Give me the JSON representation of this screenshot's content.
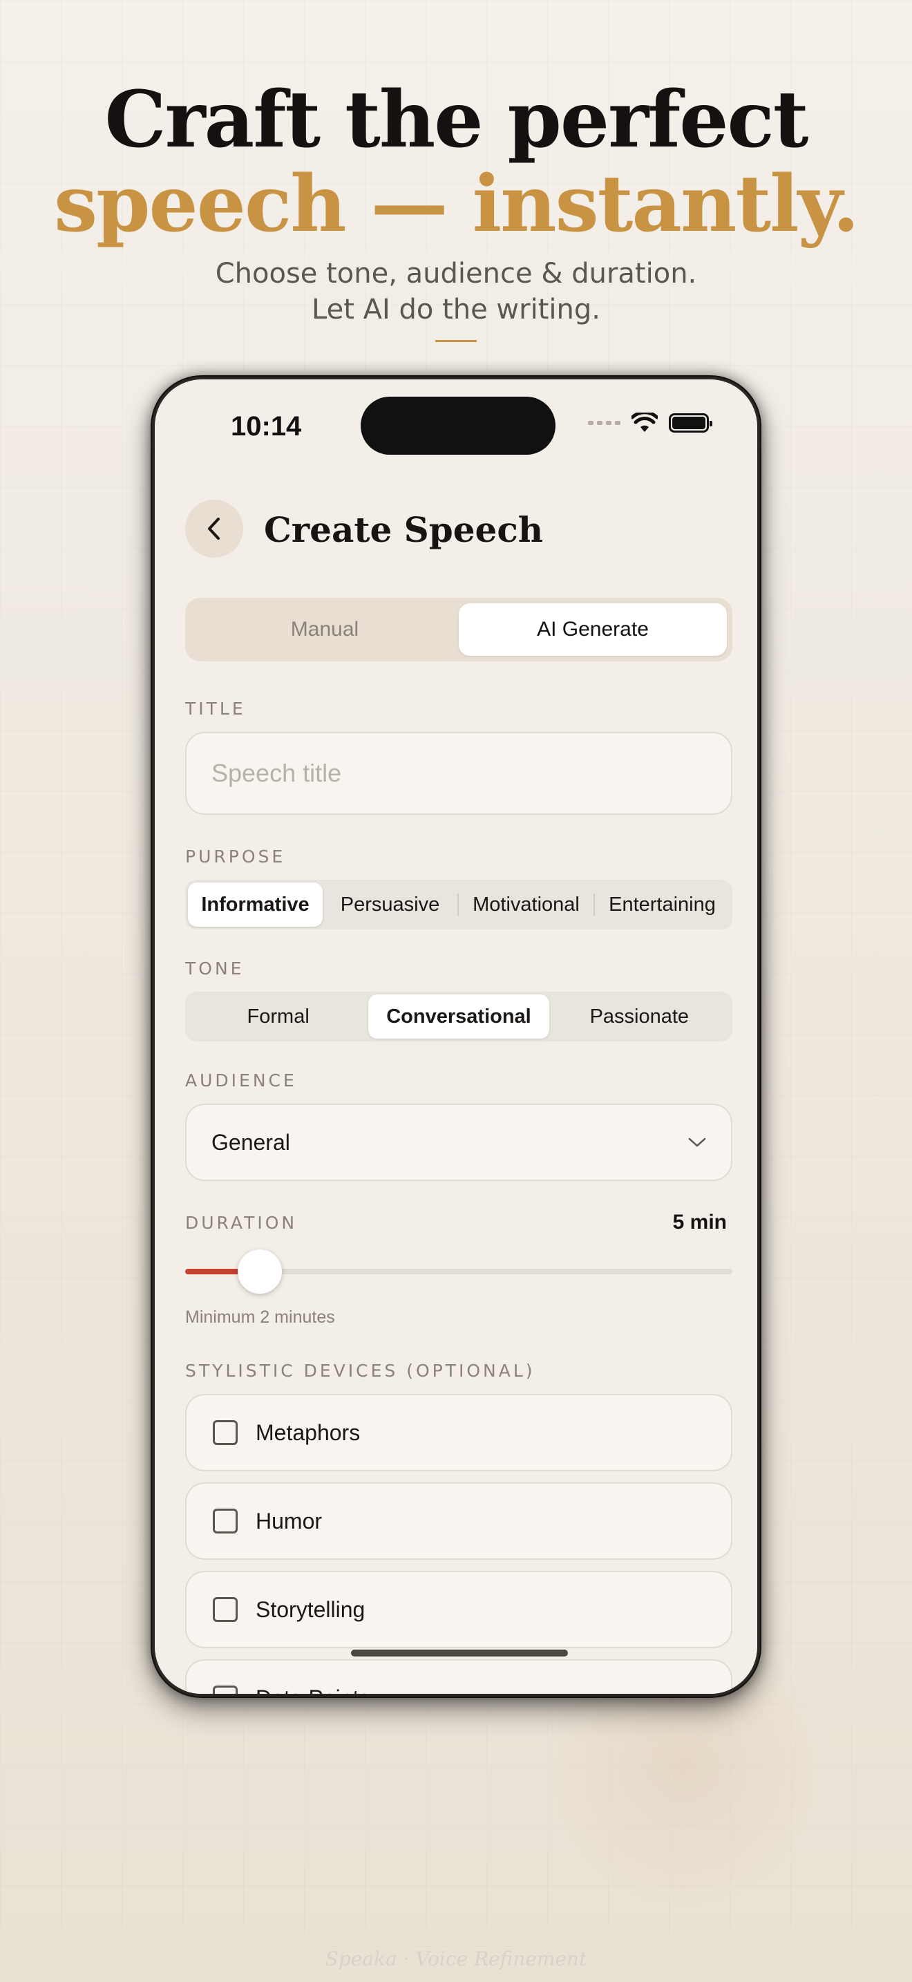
{
  "hero": {
    "line1": "Craft the perfect",
    "line2": "speech — instantly.",
    "subtitle1": "Choose tone, audience & duration.",
    "subtitle2": "Let AI do the writing."
  },
  "status_bar": {
    "time": "10:14"
  },
  "screen": {
    "title": "Create Speech",
    "mode_tabs": [
      "Manual",
      "AI Generate"
    ],
    "active_mode": "AI Generate"
  },
  "title_field": {
    "label": "TITLE",
    "placeholder": "Speech title",
    "value": ""
  },
  "purpose": {
    "label": "PURPOSE",
    "options": [
      "Informative",
      "Persuasive",
      "Motivational",
      "Entertaining"
    ],
    "selected": "Informative"
  },
  "tone": {
    "label": "TONE",
    "options": [
      "Formal",
      "Conversational",
      "Passionate"
    ],
    "selected": "Conversational"
  },
  "audience": {
    "label": "AUDIENCE",
    "value": "General"
  },
  "duration": {
    "label": "DURATION",
    "value_text": "5 min",
    "fraction": 0.136,
    "hint": "Minimum 2 minutes"
  },
  "stylistic": {
    "label": "STYLISTIC DEVICES (OPTIONAL)",
    "items": [
      "Metaphors",
      "Humor",
      "Storytelling",
      "Data Points"
    ]
  },
  "footer": {
    "brand": "Speaka · Voice Refinement"
  },
  "colors": {
    "accent_gold": "#c99344",
    "slider_red": "#c4402f",
    "background": "#f3efe8"
  }
}
